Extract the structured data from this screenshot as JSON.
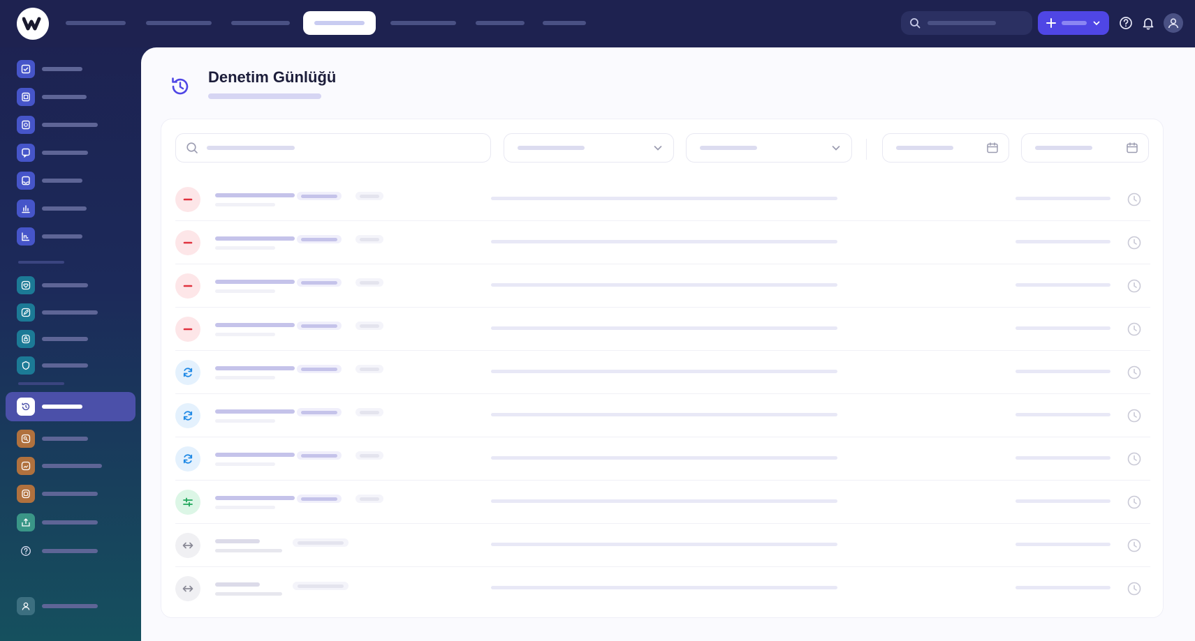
{
  "page": {
    "title": "Denetim Günlüğü",
    "icon": "history-icon"
  },
  "topbar": {
    "logo": "w-logo",
    "nav_items": 7,
    "active_nav_index": 3,
    "search_icon": "search-icon",
    "new_button_icon": "plus-icon",
    "help_icon": "help-circle-icon",
    "notification_icon": "bell-icon",
    "avatar_icon": "user-icon"
  },
  "sidebar": {
    "active_item": "history",
    "items": [
      {
        "icon": "checkbox-icon",
        "color": "blue"
      },
      {
        "icon": "document-icon",
        "color": "blue"
      },
      {
        "icon": "document-icon",
        "color": "blue"
      },
      {
        "icon": "chat-icon",
        "color": "blue"
      },
      {
        "icon": "inbox-icon",
        "color": "blue"
      },
      {
        "icon": "bar-chart-icon",
        "color": "blue"
      },
      {
        "icon": "line-chart-icon",
        "color": "blue"
      },
      {
        "icon": "heart-icon",
        "color": "teal"
      },
      {
        "icon": "edit-icon",
        "color": "teal"
      },
      {
        "icon": "lock-icon",
        "color": "teal"
      },
      {
        "icon": "shield-icon",
        "color": "teal"
      },
      {
        "icon": "history-icon",
        "color": "white",
        "active": true
      },
      {
        "icon": "key-icon",
        "color": "brown"
      },
      {
        "icon": "image-icon",
        "color": "brown"
      },
      {
        "icon": "box-icon",
        "color": "brown"
      },
      {
        "icon": "export-icon",
        "color": "green"
      },
      {
        "icon": "help-circle-icon",
        "color": "plain"
      },
      {
        "icon": "user-icon",
        "color": "plain"
      }
    ]
  },
  "filters": {
    "search_icon": "search-icon",
    "dropdown_icon": "chevron-down-icon",
    "calendar_icon": "calendar-icon"
  },
  "colors": {
    "accent": "#4f46e5",
    "delete": "#e0323e",
    "update": "#1e88e5",
    "config": "#1fa65a",
    "neutral": "#8a8a96"
  },
  "log_rows": [
    {
      "type": "delete",
      "icon": "minus-icon"
    },
    {
      "type": "delete",
      "icon": "minus-icon"
    },
    {
      "type": "delete",
      "icon": "minus-icon"
    },
    {
      "type": "delete",
      "icon": "minus-icon"
    },
    {
      "type": "update",
      "icon": "refresh-icon"
    },
    {
      "type": "update",
      "icon": "refresh-icon"
    },
    {
      "type": "update",
      "icon": "refresh-icon"
    },
    {
      "type": "config",
      "icon": "sliders-icon"
    },
    {
      "type": "transfer",
      "icon": "arrow-left-right-icon"
    },
    {
      "type": "transfer",
      "icon": "arrow-left-right-icon"
    }
  ]
}
